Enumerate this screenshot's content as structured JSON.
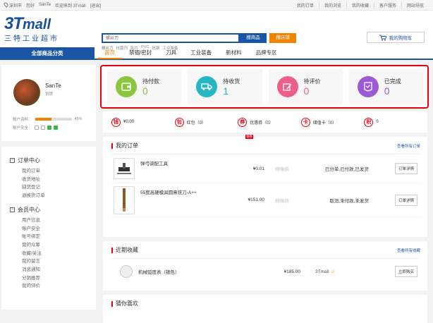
{
  "topbar": {
    "location": "深圳市",
    "greeting": "您好",
    "username": "SanTe",
    "welcome": "欢迎来到 3Tmall",
    "logout": "[退出]",
    "links": [
      "我的订单",
      "我的浏览",
      "我的收藏",
      "客户服务",
      "网站导航"
    ]
  },
  "logo": {
    "brand_big": "3T",
    "brand_mall": "mall",
    "tagline": "三特工业超市"
  },
  "search": {
    "placeholder": "螺丝刀",
    "search_btn": "搜商品",
    "shop_btn": "搜店铺",
    "hot": [
      "螺丝刀",
      "抗菌剂",
      "贴片",
      "PVC",
      "玛钢",
      "工业装备"
    ]
  },
  "cart": {
    "label": "我的购物车",
    "icon": "cart-icon"
  },
  "nav": {
    "all_categories": "全部商品分类",
    "items": [
      "首页",
      "禁锢/密封",
      "刀具",
      "工业装备",
      "新材料",
      "品牌专区"
    ],
    "active_index": 0
  },
  "profile": {
    "name": "SanTe",
    "level": "铜牌",
    "account_info_label": "账户资料：",
    "progress_percent": "45%",
    "progress": 45,
    "security_label": "账户安全："
  },
  "menu": {
    "order_center": {
      "title": "订单中心",
      "items": [
        "我的订单",
        "收货地址",
        "缺货登记",
        "退换货订单"
      ]
    },
    "member_center": {
      "title": "会员中心",
      "items": [
        "用户信息",
        "账户安全",
        "账号绑定",
        "我的众筹",
        "收藏/关注",
        "我的留言",
        "消息通知",
        "分销推荐",
        "我的评价"
      ]
    }
  },
  "stats": [
    {
      "label": "待付款",
      "value": "0",
      "color": "#8cc63f",
      "icon": "wallet-icon"
    },
    {
      "label": "待收货",
      "value": "1",
      "color": "#29b6c4",
      "icon": "truck-icon"
    },
    {
      "label": "待评价",
      "value": "0",
      "color": "#ec5f8a",
      "icon": "edit-icon"
    },
    {
      "label": "已完成",
      "value": "0",
      "color": "#9b59d6",
      "icon": "done-icon"
    }
  ],
  "wallet": [
    {
      "icon": "钱",
      "label": "¥0.00"
    },
    {
      "icon": "包",
      "label": "红包（0）"
    },
    {
      "icon": "券",
      "label": "优惠券（0）",
      "badge": "领券"
    },
    {
      "icon": "卡",
      "label": "储值卡（0）"
    },
    {
      "icon": "积",
      "label": "0"
    }
  ],
  "orders": {
    "title": "我的订单",
    "more": "查看所有订单",
    "rows": [
      {
        "name": "弹弓骑配工具",
        "price": "¥0.01",
        "shop": "特殊供",
        "status": "已分单,已付款,已发货",
        "btn": "订单详情"
      },
      {
        "name": "55度高硬模具圆鼻铣刀-A++",
        "price": "¥151.00",
        "shop": "特殊供",
        "status": "取消,未付款,未发货",
        "btn": "订单详情"
      }
    ]
  },
  "favorites": {
    "title": "近期收藏",
    "more": "查看所有收藏",
    "rows": [
      {
        "name": "机械弧度表（银色）",
        "price": "¥185.00",
        "shop": "3Tmall",
        "btn": "立即购买"
      }
    ]
  },
  "guess": {
    "title": "猜你喜欢"
  }
}
